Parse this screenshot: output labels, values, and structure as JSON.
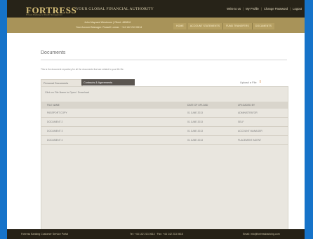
{
  "header": {
    "logo": "FORTRESS",
    "logo_sub": "Private Banking & Wealth Management",
    "tagline": "YOUR GLOBAL FINANCIAL AUTHORITY",
    "nav": [
      "Write to us",
      "My Profile",
      "Change Password",
      "Logout"
    ]
  },
  "subheader": {
    "welcome_line1": "John Maynard Westmore  |  Client: 465816",
    "welcome_line2": "Your Account Manager: Russell Lomax · +44 142 213 0614",
    "main_nav": [
      "HOME",
      "ACCOUNT STATEMENTS",
      "FUND TRANSFERS",
      "DOCUMENTS"
    ]
  },
  "page": {
    "title": "Documents",
    "intro": "This is the document repository for all the documents that are related to your life file.",
    "tabs": [
      "Personal Documents",
      "Contracts & Agreements"
    ],
    "active_tab": "Contracts & Agreements",
    "upload_label": "Upload a File",
    "hint": "Click on File Name to Open / Download",
    "table": {
      "headers": [
        "FILE NAME",
        "DATE OF UPLOAD",
        "UPLOADED BY"
      ],
      "rows": [
        [
          "PASSPORT COPY",
          "01 JUNE 2013",
          "ADMINISTRATOR"
        ],
        [
          "DOCUMENT 2",
          "01 JUNE 2013",
          "SELF"
        ],
        [
          "DOCUMENT 3",
          "01 JUNE 2013",
          "ACCOUNT MANAGER"
        ],
        [
          "DOCUMENT 4",
          "01 JUNE 2013",
          "PLACEMENT AGENT"
        ]
      ]
    }
  },
  "footer": {
    "service": "Fortress Banking Customer Service Portal",
    "contact": "Tel: +44 142 213 0614 · Fax: +44 142 213 0615",
    "email": "Email: info@fortressbanking.com"
  },
  "colors": {
    "frame": "#1673c9",
    "header": "#272318",
    "subheader": "#a89359",
    "panel": "#e9e6df",
    "active_tab": "#5a5550"
  }
}
